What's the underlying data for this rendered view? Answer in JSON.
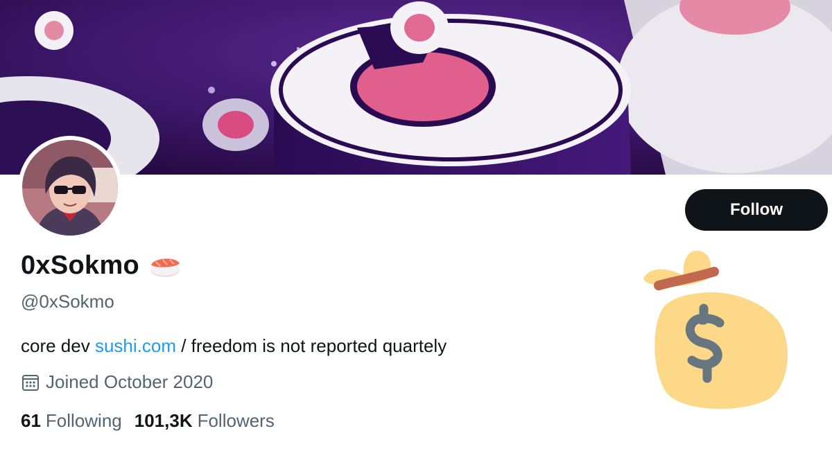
{
  "profile": {
    "display_name": "0xSokmo",
    "name_emoji": "sushi-icon",
    "handle": "@0xSokmo",
    "bio": {
      "prefix": "core dev ",
      "link_text": "sushi.com",
      "suffix": " / freedom is not reported quartely"
    },
    "joined": "Joined October 2020",
    "following_count": "61",
    "following_label": "Following",
    "followers_count": "101,3K",
    "followers_label": "Followers"
  },
  "actions": {
    "follow_label": "Follow"
  },
  "icons": {
    "calendar": "calendar-icon",
    "money_bag": "money-bag-icon",
    "avatar": "avatar-image"
  },
  "colors": {
    "link": "#1d9bf0",
    "secondary_text": "#536471",
    "primary_text": "#0f1419",
    "button_bg": "#0f1419",
    "banner_purple": "#3a1466",
    "banner_pink": "#e2678f"
  }
}
